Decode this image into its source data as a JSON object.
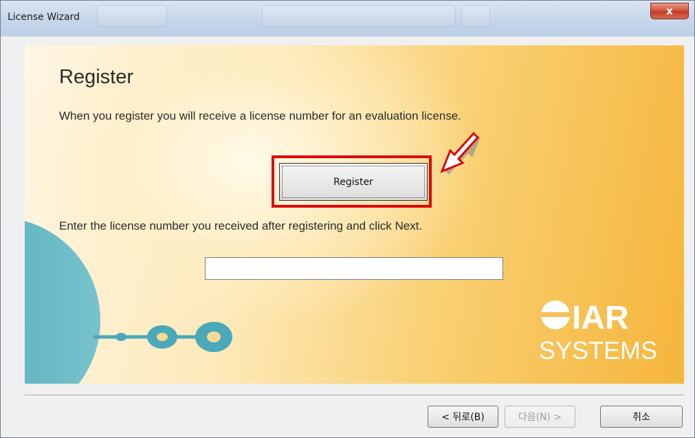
{
  "window": {
    "title": "License Wizard",
    "close_label": "x"
  },
  "page": {
    "heading": "Register",
    "intro": "When you register you will receive a license number for an evaluation license.",
    "register_button_label": "Register",
    "instruction": "Enter the license number you received after registering and click Next.",
    "license_input_value": ""
  },
  "logo": {
    "line1": "IAR",
    "line2": "SYSTEMS"
  },
  "footer": {
    "back_label": "< 뒤로(B)",
    "next_label": "다음(N) >",
    "cancel_label": "취소"
  },
  "colors": {
    "highlight": "#e0000b",
    "banner_warm": "#f5b53c",
    "accent_teal": "#4aa9b9"
  }
}
